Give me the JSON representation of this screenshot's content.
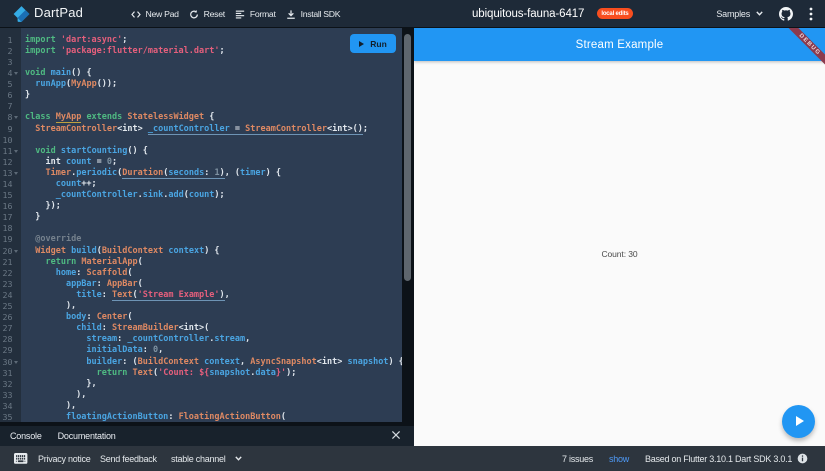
{
  "header": {
    "brand": "DartPad",
    "nav": [
      {
        "icon": "code",
        "label": "New Pad"
      },
      {
        "icon": "reset",
        "label": "Reset"
      },
      {
        "icon": "format",
        "label": "Format"
      },
      {
        "icon": "download",
        "label": "Install SDK"
      }
    ],
    "pad_title": "ubiquitous-fauna-6417",
    "badge": "local edits",
    "samples_label": "Samples"
  },
  "editor": {
    "run_label": "Run",
    "fold_lines": [
      4,
      8,
      11,
      13,
      20,
      30
    ],
    "lines": [
      [
        [
          "kw",
          "import"
        ],
        [
          "pl",
          " "
        ],
        [
          "str",
          "'dart:async'"
        ],
        [
          "pl",
          ";"
        ]
      ],
      [
        [
          "kw",
          "import"
        ],
        [
          "pl",
          " "
        ],
        [
          "str",
          "'package:flutter/material.dart'"
        ],
        [
          "pl",
          ";"
        ]
      ],
      [],
      [
        [
          "kw",
          "void"
        ],
        [
          "pl",
          " "
        ],
        [
          "id",
          "main"
        ],
        [
          "pl",
          "() {"
        ]
      ],
      [
        [
          "pl",
          "  "
        ],
        [
          "id",
          "runApp"
        ],
        [
          "pl",
          "("
        ],
        [
          "ty",
          "MyApp"
        ],
        [
          "pl",
          "());"
        ]
      ],
      [
        [
          "pl",
          "}"
        ]
      ],
      [],
      [
        [
          "kw",
          "class"
        ],
        [
          "pl",
          " "
        ],
        [
          "ty",
          "MyApp",
          "y"
        ],
        [
          "pl",
          " "
        ],
        [
          "kw",
          "extends"
        ],
        [
          "pl",
          " "
        ],
        [
          "ty",
          "StatelessWidget"
        ],
        [
          "pl",
          " {"
        ]
      ],
      [
        [
          "pl",
          "  "
        ],
        [
          "ty",
          "StreamController"
        ],
        [
          "pl",
          "<int> "
        ],
        [
          "id",
          "_countController",
          "b"
        ],
        [
          "pl",
          " = ",
          "b"
        ],
        [
          "ty",
          "StreamController",
          "b"
        ],
        [
          "pl",
          "<int>()",
          "b"
        ],
        [
          "pl",
          ";"
        ]
      ],
      [],
      [
        [
          "pl",
          "  "
        ],
        [
          "kw",
          "void"
        ],
        [
          "pl",
          " "
        ],
        [
          "id",
          "startCounting"
        ],
        [
          "pl",
          "() {"
        ]
      ],
      [
        [
          "pl",
          "    int "
        ],
        [
          "id",
          "count"
        ],
        [
          "pl",
          " = "
        ],
        [
          "num",
          "0"
        ],
        [
          "pl",
          ";"
        ]
      ],
      [
        [
          "pl",
          "    "
        ],
        [
          "ty",
          "Timer"
        ],
        [
          "pl",
          "."
        ],
        [
          "id",
          "periodic"
        ],
        [
          "pl",
          "("
        ],
        [
          "ty",
          "Duration",
          "b"
        ],
        [
          "pl",
          "(",
          "b"
        ],
        [
          "id",
          "seconds",
          "b"
        ],
        [
          "pl",
          ": ",
          "b"
        ],
        [
          "num",
          "1",
          "b"
        ],
        [
          "pl",
          ")",
          "b"
        ],
        [
          "pl",
          ", ("
        ],
        [
          "id",
          "timer"
        ],
        [
          "pl",
          ") {"
        ]
      ],
      [
        [
          "pl",
          "      "
        ],
        [
          "id",
          "count"
        ],
        [
          "pl",
          "++;"
        ]
      ],
      [
        [
          "pl",
          "      "
        ],
        [
          "id",
          "_countController"
        ],
        [
          "pl",
          "."
        ],
        [
          "id",
          "sink"
        ],
        [
          "pl",
          "."
        ],
        [
          "id",
          "add"
        ],
        [
          "pl",
          "("
        ],
        [
          "id",
          "count"
        ],
        [
          "pl",
          ");"
        ]
      ],
      [
        [
          "pl",
          "    });"
        ]
      ],
      [
        [
          "pl",
          "  }"
        ]
      ],
      [],
      [
        [
          "pl",
          "  "
        ],
        [
          "ann",
          "@override"
        ]
      ],
      [
        [
          "pl",
          "  "
        ],
        [
          "ty",
          "Widget"
        ],
        [
          "pl",
          " "
        ],
        [
          "id",
          "build"
        ],
        [
          "pl",
          "("
        ],
        [
          "ty",
          "BuildContext"
        ],
        [
          "pl",
          " "
        ],
        [
          "id",
          "context"
        ],
        [
          "pl",
          ") {"
        ]
      ],
      [
        [
          "pl",
          "    "
        ],
        [
          "kw",
          "return"
        ],
        [
          "pl",
          " "
        ],
        [
          "ty",
          "MaterialApp"
        ],
        [
          "pl",
          "("
        ]
      ],
      [
        [
          "pl",
          "      "
        ],
        [
          "id",
          "home"
        ],
        [
          "pl",
          ": "
        ],
        [
          "ty",
          "Scaffold"
        ],
        [
          "pl",
          "("
        ]
      ],
      [
        [
          "pl",
          "        "
        ],
        [
          "id",
          "appBar"
        ],
        [
          "pl",
          ": "
        ],
        [
          "ty",
          "AppBar"
        ],
        [
          "pl",
          "("
        ]
      ],
      [
        [
          "pl",
          "          "
        ],
        [
          "id",
          "title"
        ],
        [
          "pl",
          ": "
        ],
        [
          "ty",
          "Text",
          "b"
        ],
        [
          "pl",
          "(",
          "b"
        ],
        [
          "str",
          "'Stream Example'",
          "b"
        ],
        [
          "pl",
          ")",
          "b"
        ],
        [
          "pl",
          ","
        ]
      ],
      [
        [
          "pl",
          "        ),"
        ]
      ],
      [
        [
          "pl",
          "        "
        ],
        [
          "id",
          "body"
        ],
        [
          "pl",
          ": "
        ],
        [
          "ty",
          "Center"
        ],
        [
          "pl",
          "("
        ]
      ],
      [
        [
          "pl",
          "          "
        ],
        [
          "id",
          "child"
        ],
        [
          "pl",
          ": "
        ],
        [
          "ty",
          "StreamBuilder"
        ],
        [
          "pl",
          "<int>("
        ]
      ],
      [
        [
          "pl",
          "            "
        ],
        [
          "id",
          "stream"
        ],
        [
          "pl",
          ": "
        ],
        [
          "id",
          "_countController"
        ],
        [
          "pl",
          "."
        ],
        [
          "id",
          "stream"
        ],
        [
          "pl",
          ","
        ]
      ],
      [
        [
          "pl",
          "            "
        ],
        [
          "id",
          "initialData"
        ],
        [
          "pl",
          ": "
        ],
        [
          "num",
          "0"
        ],
        [
          "pl",
          ","
        ]
      ],
      [
        [
          "pl",
          "            "
        ],
        [
          "id",
          "builder"
        ],
        [
          "pl",
          ": ("
        ],
        [
          "ty",
          "BuildContext"
        ],
        [
          "pl",
          " "
        ],
        [
          "id",
          "context"
        ],
        [
          "pl",
          ", "
        ],
        [
          "ty",
          "AsyncSnapshot"
        ],
        [
          "pl",
          "<int> "
        ],
        [
          "id",
          "snapshot"
        ],
        [
          "pl",
          ") {"
        ]
      ],
      [
        [
          "pl",
          "              "
        ],
        [
          "kw",
          "return"
        ],
        [
          "pl",
          " "
        ],
        [
          "ty",
          "Text"
        ],
        [
          "pl",
          "("
        ],
        [
          "str",
          "'Count: "
        ],
        [
          "str",
          "${"
        ],
        [
          "id",
          "snapshot"
        ],
        [
          "pl",
          "."
        ],
        [
          "id",
          "data"
        ],
        [
          "str",
          "}'"
        ],
        [
          "pl",
          ");"
        ]
      ],
      [
        [
          "pl",
          "            },"
        ]
      ],
      [
        [
          "pl",
          "          ),"
        ]
      ],
      [
        [
          "pl",
          "        ),"
        ]
      ],
      [
        [
          "pl",
          "        "
        ],
        [
          "id",
          "floatingActionButton"
        ],
        [
          "pl",
          ": "
        ],
        [
          "ty",
          "FloatingActionButton"
        ],
        [
          "pl",
          "("
        ]
      ]
    ]
  },
  "console": {
    "tabs": [
      "Console",
      "Documentation"
    ],
    "close": "×"
  },
  "preview": {
    "appbar_title": "Stream Example",
    "debug_banner": "DEBUG",
    "body_text": "Count: 30"
  },
  "footer": {
    "privacy": "Privacy notice",
    "feedback": "Send feedback",
    "channel": "stable channel",
    "issues": "7 issues",
    "show": "show",
    "based": "Based on Flutter 3.10.1 Dart SDK 3.0.1"
  },
  "colors": {
    "accent_blue": "#2196f3",
    "badge_orange": "#f84e1f",
    "debug_banner_maroon": "#8b3b4f",
    "link_blue": "#4f9bf8",
    "editor_selection": "#2d3d53"
  }
}
